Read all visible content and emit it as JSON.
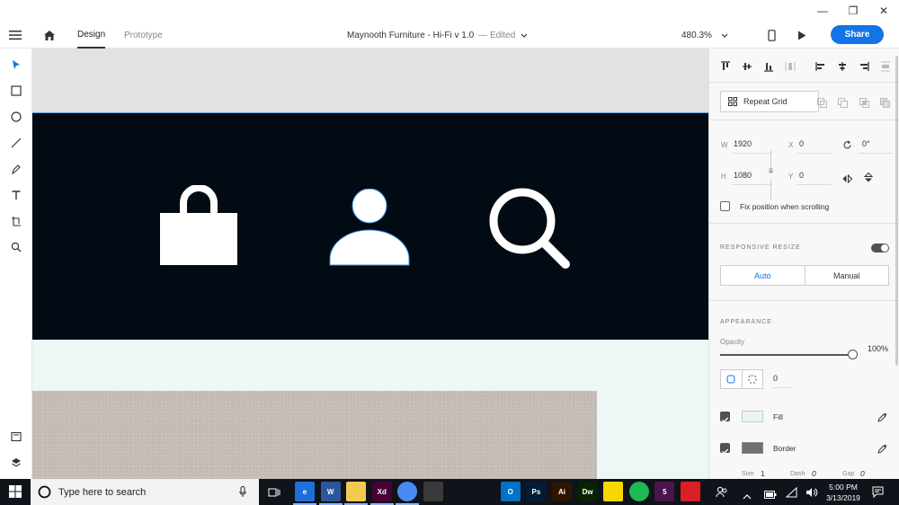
{
  "window": {
    "minimize": "—",
    "maximize": "❐",
    "close": "✕"
  },
  "appbar": {
    "tabs": [
      {
        "label": "Design"
      },
      {
        "label": "Prototype"
      }
    ],
    "doc_title": "Maynooth Furniture - Hi-Fi v 1.0",
    "doc_status": "— Edited",
    "zoom": "480.3%",
    "share_label": "Share"
  },
  "tools": [
    "select-icon",
    "rectangle-icon",
    "ellipse-icon",
    "line-icon",
    "pen-icon",
    "text-icon",
    "artboard-icon",
    "zoom-icon",
    "assets-icon",
    "layers-icon"
  ],
  "canvas": {
    "header_bg": "#020a14",
    "icons": [
      "shopping-bag-icon",
      "user-icon",
      "search-icon"
    ]
  },
  "panel": {
    "repeat_grid_label": "Repeat Grid",
    "w_label": "W",
    "w_value": "1920",
    "x_label": "X",
    "x_value": "0",
    "rotation_value": "0°",
    "h_label": "H",
    "h_value": "1080",
    "y_label": "Y",
    "y_value": "0",
    "fix_position_label": "Fix position when scrolling",
    "responsive_resize_title": "RESPONSIVE RESIZE",
    "auto_label": "Auto",
    "manual_label": "Manual",
    "appearance_title": "APPEARANCE",
    "opacity_label": "Opacity",
    "opacity_value": "100%",
    "opacity_fraction": 1.0,
    "radius_value": "0",
    "fill_label": "Fill",
    "fill_color": "#e9f5f2",
    "border_label": "Border",
    "border_color": "#707070",
    "size_label": "Size",
    "size_value": "1",
    "dash_label": "Dash",
    "dash_value": "0",
    "gap_label": "Gap",
    "gap_value": "0"
  },
  "taskbar": {
    "search_placeholder": "Type here to search",
    "time": "5:00 PM",
    "date": "3/13/2019",
    "apps": [
      {
        "name": "edge",
        "label": "e",
        "color": "#1e6fd9"
      },
      {
        "name": "word",
        "label": "W",
        "color": "#2b579a"
      },
      {
        "name": "file-explorer",
        "label": "",
        "color": "#f3c94f"
      },
      {
        "name": "xd",
        "label": "Xd",
        "color": "#470137"
      },
      {
        "name": "chrome",
        "label": "",
        "color": "#4a8af4"
      },
      {
        "name": "store",
        "label": "",
        "color": "#3a3a3a"
      },
      {
        "name": "dropbox",
        "label": "",
        "color": "#10131a"
      },
      {
        "name": "calendar",
        "label": "",
        "color": "#10131a"
      },
      {
        "name": "outlook",
        "label": "O",
        "color": "#0072c6"
      },
      {
        "name": "photoshop",
        "label": "Ps",
        "color": "#001d34"
      },
      {
        "name": "illustrator",
        "label": "Ai",
        "color": "#2f1400"
      },
      {
        "name": "dreamweaver",
        "label": "Dw",
        "color": "#072401"
      },
      {
        "name": "sticky-notes",
        "label": "",
        "color": "#f5d800"
      },
      {
        "name": "spotify",
        "label": "",
        "color": "#1db954"
      },
      {
        "name": "slack",
        "label": "5",
        "color": "#4a154b"
      },
      {
        "name": "creative-cloud",
        "label": "",
        "color": "#da1f26"
      }
    ]
  }
}
